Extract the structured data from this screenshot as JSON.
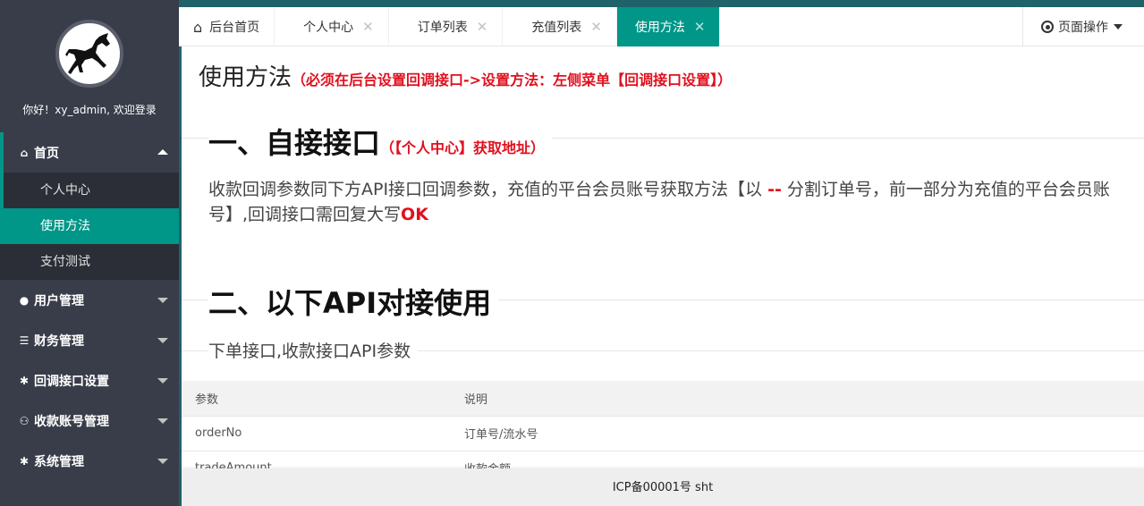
{
  "sidebar": {
    "welcome": "你好！xy_admin, 欢迎登录",
    "menu": [
      {
        "label": "首页",
        "icon": "home-icon"
      },
      {
        "label": "用户管理",
        "icon": "user-icon"
      },
      {
        "label": "财务管理",
        "icon": "list-icon"
      },
      {
        "label": "回调接口设置",
        "icon": "gear-icon"
      },
      {
        "label": "收款账号管理",
        "icon": "users-icon"
      },
      {
        "label": "系统管理",
        "icon": "gear-icon"
      }
    ],
    "submenu": [
      "个人中心",
      "使用方法",
      "支付测试"
    ]
  },
  "tabs": [
    {
      "label": "后台首页",
      "icon": "home-icon"
    },
    {
      "label": "个人中心"
    },
    {
      "label": "订单列表"
    },
    {
      "label": "充值列表"
    },
    {
      "label": "使用方法",
      "active": true
    }
  ],
  "page_ops": "页面操作",
  "content": {
    "title": "使用方法",
    "title_note": "（必须在后台设置回调接口->设置方法：左侧菜单【回调接口设置】）",
    "section1": "一、自接接口",
    "section1_note": "（【个人中心】获取地址）",
    "para_a": "收款回调参数同下方API接口回调参数，充值的平台会员账号获取方法【以 ",
    "para_sep": "--",
    "para_b": " 分割订单号，前一部分为充值的平台会员账号】,回调接口需回复大写",
    "para_ok": "OK",
    "section2": "二、以下API对接使用",
    "subtitle": "下单接口,收款接口API参数"
  },
  "table": {
    "headers": [
      "参数",
      "说明"
    ],
    "rows": [
      [
        "orderNo",
        "订单号/流水号"
      ],
      [
        "tradeAmount",
        "收款金额"
      ]
    ]
  },
  "footer": "ICP备00001号 sht",
  "colors": {
    "accent": "#009688",
    "sidebar": "#393D49",
    "note_red": "#e0101e"
  }
}
